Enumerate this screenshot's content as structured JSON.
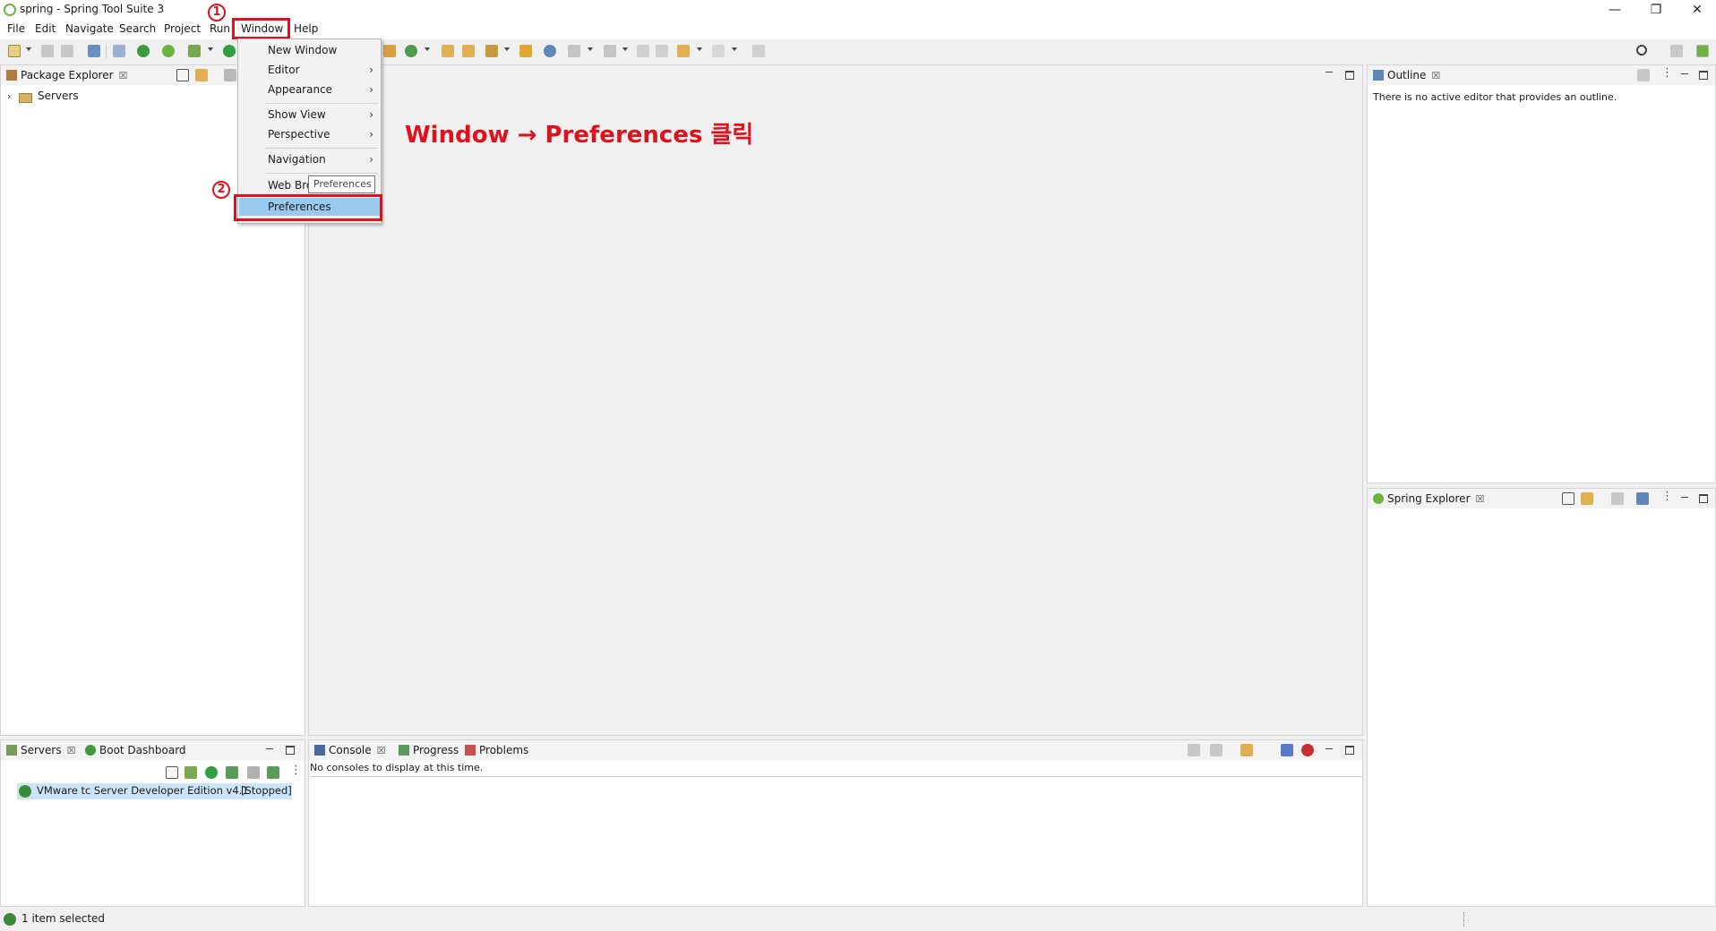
{
  "window": {
    "title": "spring - Spring Tool Suite 3",
    "controls": {
      "minimize": "—",
      "restore": "❐",
      "close": "✕"
    }
  },
  "menubar": [
    "File",
    "Edit",
    "Navigate",
    "Search",
    "Project",
    "Run",
    "Window",
    "Help"
  ],
  "window_menu": {
    "items": [
      {
        "label": "New Window",
        "submenu": false
      },
      {
        "label": "Editor",
        "submenu": true
      },
      {
        "label": "Appearance",
        "submenu": true
      },
      {
        "label": "Show View",
        "submenu": true
      },
      {
        "label": "Perspective",
        "submenu": true
      },
      {
        "label": "Navigation",
        "submenu": true
      },
      {
        "label": "Web Bro",
        "submenu": false
      },
      {
        "label": "Preferences",
        "submenu": false,
        "highlighted": true
      }
    ],
    "tooltip": "Preferences",
    "arrow_glyph": "›"
  },
  "annotations": {
    "step1": "1",
    "step2": "2",
    "instruction": "Window → Preferences 클릭",
    "color": "#e0111c"
  },
  "package_explorer": {
    "tab": "Package Explorer",
    "tree": [
      {
        "label": "Servers",
        "expander": "›"
      }
    ]
  },
  "outline": {
    "tab": "Outline",
    "message": "There is no active editor that provides an outline."
  },
  "spring_explorer": {
    "tab": "Spring Explorer"
  },
  "servers_panel": {
    "tabs": [
      "Servers",
      "Boot Dashboard"
    ],
    "server": {
      "name": "VMware tc Server Developer Edition v4.1",
      "status": "[Stopped]"
    }
  },
  "console_panel": {
    "tabs": [
      "Console",
      "Progress",
      "Problems"
    ],
    "message": "No consoles to display at this time."
  },
  "statusbar": {
    "text": "1 item selected"
  },
  "close_glyph": "☒",
  "colors": {
    "accent_green": "#6db33f",
    "selection": "#99c9ef",
    "annotation_red": "#e0111c"
  }
}
